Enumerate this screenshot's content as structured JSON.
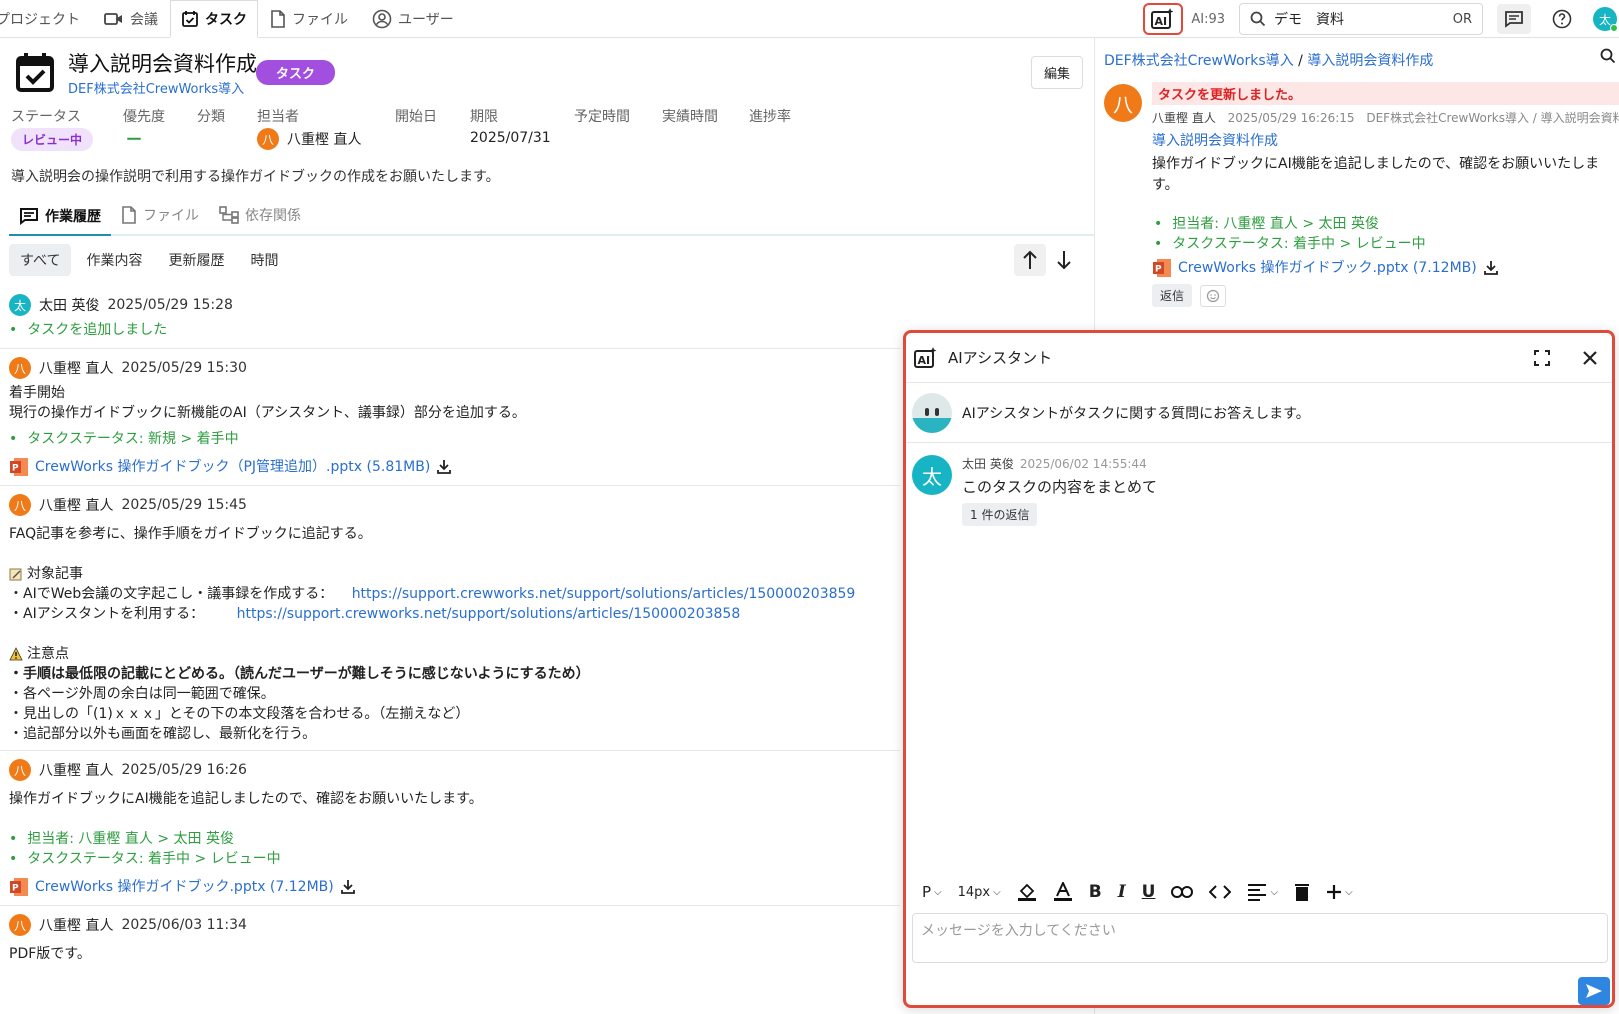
{
  "nav": {
    "items": [
      {
        "label": "プロジェクト",
        "icon": "folder-icon"
      },
      {
        "label": "会議",
        "icon": "video-icon"
      },
      {
        "label": "タスク",
        "icon": "task-icon",
        "active": true
      },
      {
        "label": "ファイル",
        "icon": "file-icon"
      },
      {
        "label": "ユーザー",
        "icon": "user-icon"
      }
    ],
    "ai_count": "AI:93",
    "search_value": "デモ　資料",
    "search_operator": "OR",
    "user_initial": "太"
  },
  "task": {
    "title": "導入説明会資料作成",
    "project": "DEF株式会社CrewWorks導入",
    "type_badge": "タスク",
    "edit_label": "編集",
    "labels": {
      "status": "ステータス",
      "priority": "優先度",
      "category": "分類",
      "assignee": "担当者",
      "start": "開始日",
      "due": "期限",
      "planned": "予定時間",
      "actual": "実績時間",
      "progress": "進捗率"
    },
    "status": "レビュー中",
    "priority": "ー",
    "assignee_initial": "八",
    "assignee": "八重樫 直人",
    "due": "2025/07/31",
    "description": "導入説明会の操作説明で利用する操作ガイドブックの作成をお願いたします。"
  },
  "tabs": [
    {
      "label": "作業履歴",
      "icon": "history-icon",
      "active": true
    },
    {
      "label": "ファイル",
      "icon": "file-icon"
    },
    {
      "label": "依存関係",
      "icon": "dependency-icon"
    }
  ],
  "filters": [
    "すべて",
    "作業内容",
    "更新履歴",
    "時間"
  ],
  "feed": [
    {
      "initial": "太",
      "name": "太田 英俊",
      "time": "2025/05/29 15:28",
      "bullets": [
        "タスクを追加しました"
      ]
    },
    {
      "initial": "八",
      "name": "八重樫 直人",
      "time": "2025/05/29 15:30",
      "lines": [
        "着手開始",
        "現行の操作ガイドブックに新機能のAI（アシスタント、議事録）部分を追加する。"
      ],
      "bullets": [
        "タスクステータス: 新規 > 着手中"
      ],
      "file": "CrewWorks 操作ガイドブック（PJ管理追加）.pptx (5.81MB)"
    },
    {
      "initial": "八",
      "name": "八重樫 直人",
      "time": "2025/05/29 15:45",
      "intro": "FAQ記事を参考に、操作手順をガイドブックに追記する。",
      "articles_title": "対象記事",
      "articles": [
        {
          "label": "・AIでWeb会議の文字起こし・議事録を作成する：",
          "url": "https://support.crewworks.net/support/solutions/articles/150000203859"
        },
        {
          "label": "・AIアシスタントを利用する：",
          "url": "https://support.crewworks.net/support/solutions/articles/150000203858"
        }
      ],
      "notes_title": "注意点",
      "notes_bold": "・手順は最低限の記載にとどめる。（読んだユーザーが難しそうに感じないようにするため）",
      "notes": [
        "・各ページ外周の余白は同一範囲で確保。",
        "・見出しの「(1)ｘｘｘ」とその下の本文段落を合わせる。（左揃えなど）",
        "・追記部分以外も画面を確認し、最新化を行う。"
      ]
    },
    {
      "initial": "八",
      "name": "八重樫 直人",
      "time": "2025/05/29 16:26",
      "lines": [
        "操作ガイドブックにAI機能を追記しましたので、確認をお願いいたします。"
      ],
      "bullets": [
        "担当者: 八重樫 直人 > 太田 英俊",
        "タスクステータス: 着手中 > レビュー中"
      ],
      "file": "CrewWorks 操作ガイドブック.pptx (7.12MB)"
    },
    {
      "initial": "八",
      "name": "八重樫 直人",
      "time": "2025/06/03 11:34",
      "lines": [
        "PDF版です。"
      ]
    }
  ],
  "side": {
    "crumb_project": "DEF株式会社CrewWorks導入",
    "crumb_sep": " / ",
    "crumb_task": "導入説明会資料作成",
    "avatar": "八",
    "update_notice": "タスクを更新しました。",
    "author": "八重樫 直人",
    "time": "2025/05/29 16:26:15",
    "path": "DEF株式会社CrewWorks導入 / 導入説明会資料作成",
    "task_link": "導入説明会資料作成",
    "text": "操作ガイドブックにAI機能を追記しましたので、確認をお願いいたします。",
    "bullets": [
      "担当者: 八重樫 直人 > 太田 英俊",
      "タスクステータス: 着手中 > レビュー中"
    ],
    "file": "CrewWorks 操作ガイドブック.pptx (7.12MB)",
    "reply_label": "返信"
  },
  "ai": {
    "title": "AIアシスタント",
    "intro": "AIアシスタントがタスクに関する質問にお答えします。",
    "message": {
      "initial": "太",
      "name": "太田 英俊",
      "time": "2025/06/02 14:55:44",
      "text": "このタスクの内容をまとめて",
      "replies": "1 件の返信"
    },
    "toolbar": {
      "paragraph": "P",
      "font_size": "14px"
    },
    "placeholder": "メッセージを入力してください"
  },
  "colors": {
    "accent": "#2e86e0",
    "highlight": "#e14a3b",
    "status": "#8a2fd0",
    "green": "#2e9e40"
  }
}
